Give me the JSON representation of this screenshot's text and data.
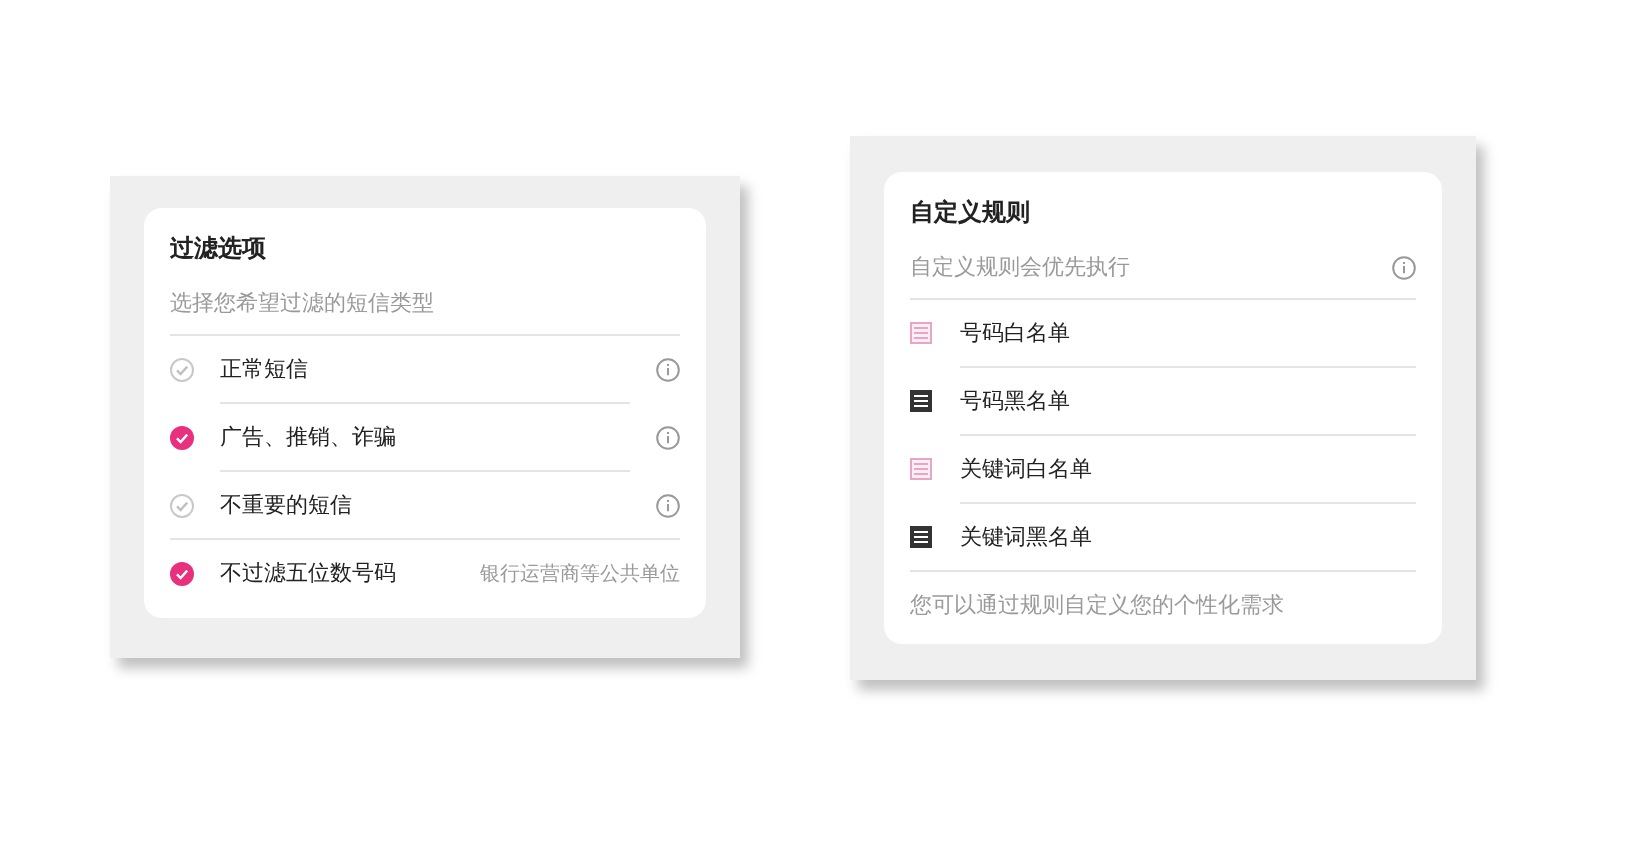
{
  "filter_options": {
    "title": "过滤选项",
    "subtitle": "选择您希望过滤的短信类型",
    "items": [
      {
        "label": "正常短信",
        "checked": false,
        "kind": "info"
      },
      {
        "label": "广告、推销、诈骗",
        "checked": true,
        "kind": "info"
      },
      {
        "label": "不重要的短信",
        "checked": false,
        "kind": "info"
      },
      {
        "label": "不过滤五位数号码",
        "checked": true,
        "kind": "note",
        "note": "银行运营商等公共单位"
      }
    ]
  },
  "custom_rules": {
    "title": "自定义规则",
    "subtitle": "自定义规则会优先执行",
    "items": [
      {
        "label": "号码白名单",
        "kind": "allow"
      },
      {
        "label": "号码黑名单",
        "kind": "block"
      },
      {
        "label": "关键词白名单",
        "kind": "allow"
      },
      {
        "label": "关键词黑名单",
        "kind": "block"
      }
    ],
    "footer": "您可以通过规则自定义您的个性化需求"
  }
}
